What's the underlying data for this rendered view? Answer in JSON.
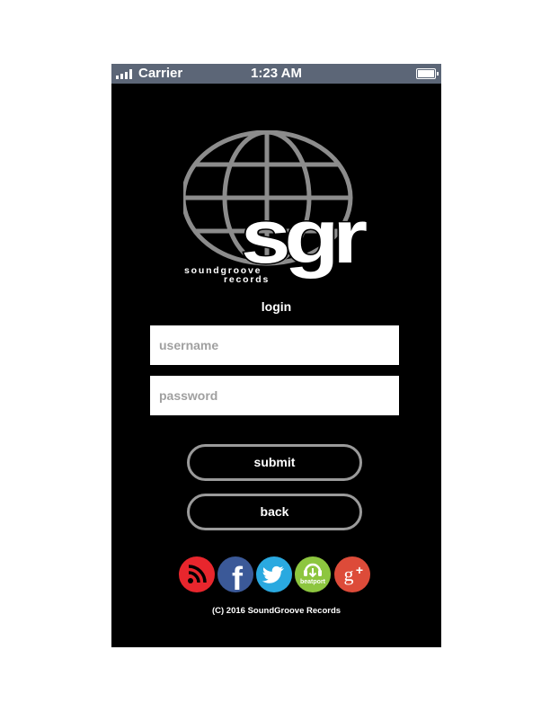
{
  "status_bar": {
    "carrier": "Carrier",
    "time": "1:23 AM"
  },
  "logo": {
    "monogram": "sgr",
    "line1": "soundgroove",
    "line2": "records",
    "globe_color": "#8c8c8c"
  },
  "login": {
    "title": "login",
    "username_placeholder": "username",
    "password_placeholder": "password",
    "submit_label": "submit",
    "back_label": "back"
  },
  "social": [
    {
      "name": "rss-icon",
      "color": "#e8262d"
    },
    {
      "name": "facebook-icon",
      "color": "#3b5998",
      "glyph": "f"
    },
    {
      "name": "twitter-icon",
      "color": "#2aa9e0"
    },
    {
      "name": "beatport-icon",
      "color": "#8dc63f",
      "glyph": "beatport"
    },
    {
      "name": "google-plus-icon",
      "color": "#dd4b39",
      "glyph": "g+"
    }
  ],
  "footer": {
    "copyright": "(C) 2016 SoundGroove Records"
  }
}
